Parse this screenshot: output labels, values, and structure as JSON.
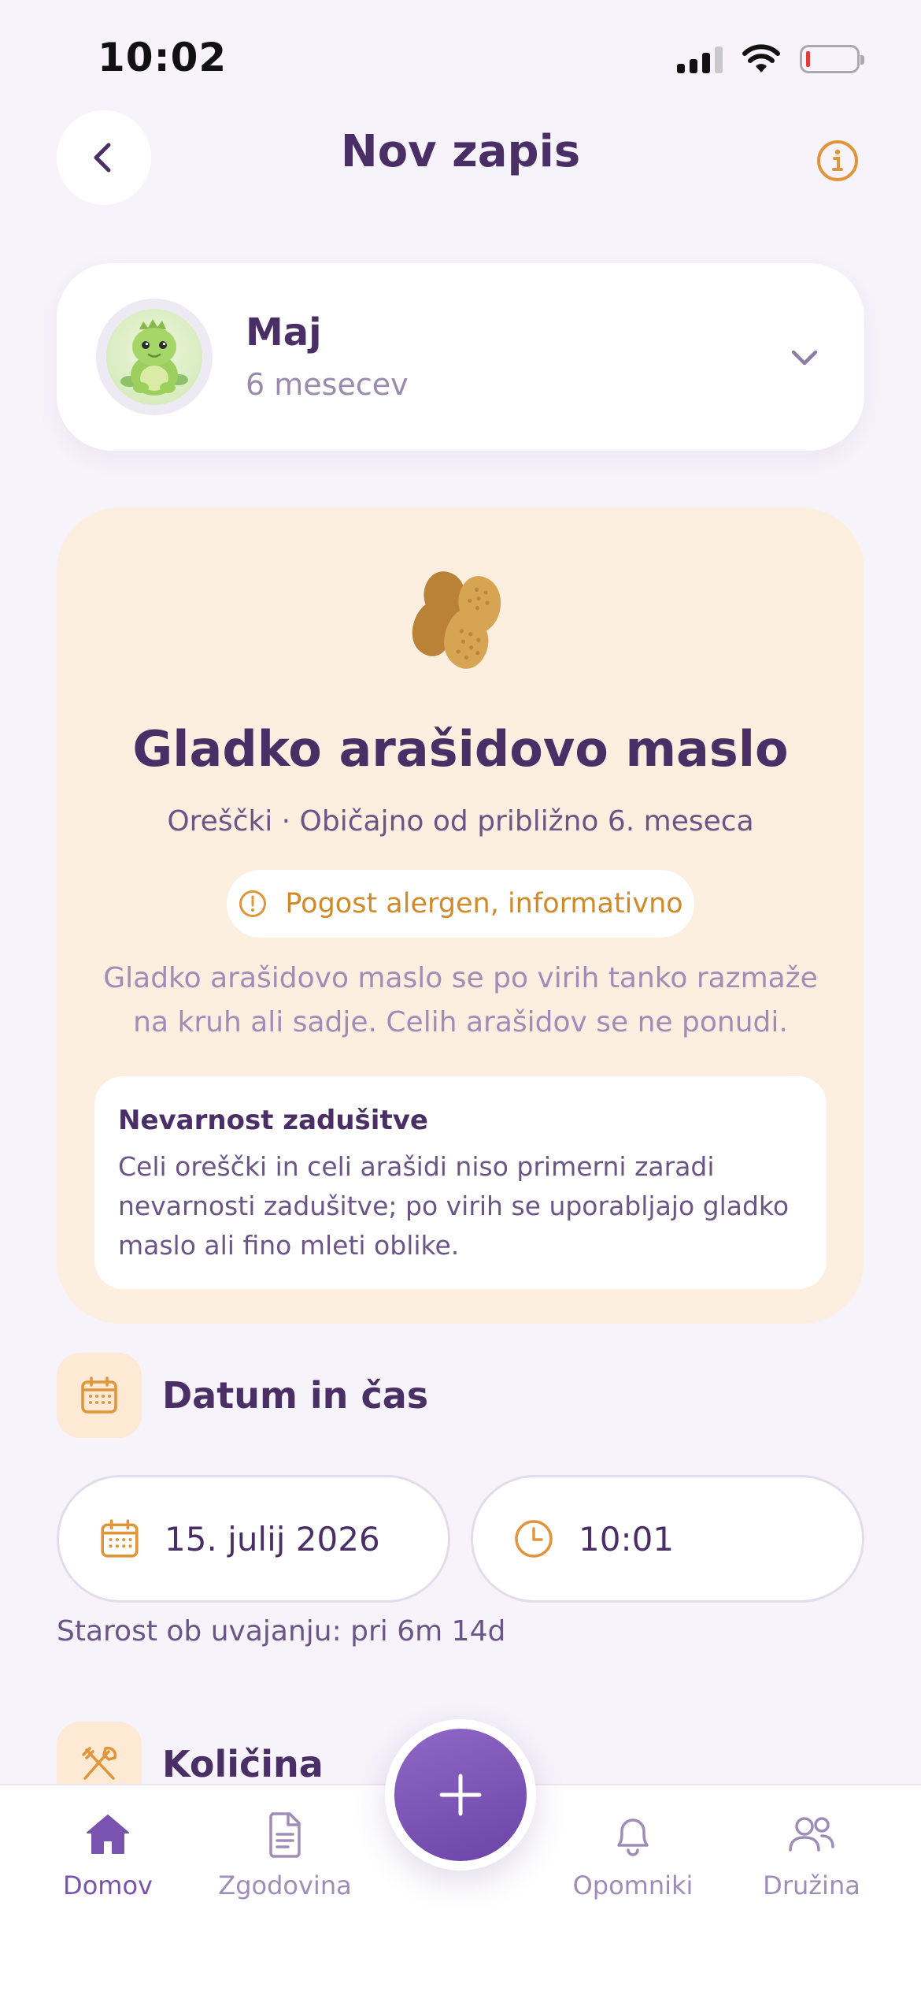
{
  "status_bar": {
    "time": "10:02",
    "battery_level": 0.05
  },
  "header": {
    "title": "Nov zapis"
  },
  "child": {
    "name": "Maj",
    "age": "6 mesecev"
  },
  "food": {
    "name": "Gladko arašidovo maslo",
    "subtitle": "Oreščki · Običajno od približno 6. meseca",
    "allergen_badge": "Pogost alergen, informativno",
    "description": "Gladko arašidovo maslo se po virih tanko razmaže na kruh ali sadje. Celih arašidov se ne ponudi.",
    "warning": {
      "title": "Nevarnost zadušitve",
      "body": "Celi oreščki in celi arašidi niso primerni zaradi nevarnosti zadušitve; po virih se uporabljajo gladko maslo ali fino mleti oblike."
    }
  },
  "datetime_section": {
    "title": "Datum in čas",
    "date": "15. julij 2026",
    "time": "10:01",
    "age_note": "Starost ob uvajanju: pri 6m 14d"
  },
  "quantity_section": {
    "title": "Količina"
  },
  "tabs": [
    {
      "label": "Domov",
      "icon": "home-icon",
      "active": true
    },
    {
      "label": "Zgodovina",
      "icon": "document-icon",
      "active": false
    },
    {
      "label": "Opomniki",
      "icon": "bell-icon",
      "active": false
    },
    {
      "label": "Družina",
      "icon": "people-icon",
      "active": false
    }
  ],
  "colors": {
    "primary": "#7a52b0",
    "accent_orange": "#e0953a",
    "text_dark": "#4a2f66",
    "background": "#f6f3fb",
    "food_card": "#fdefe0"
  }
}
